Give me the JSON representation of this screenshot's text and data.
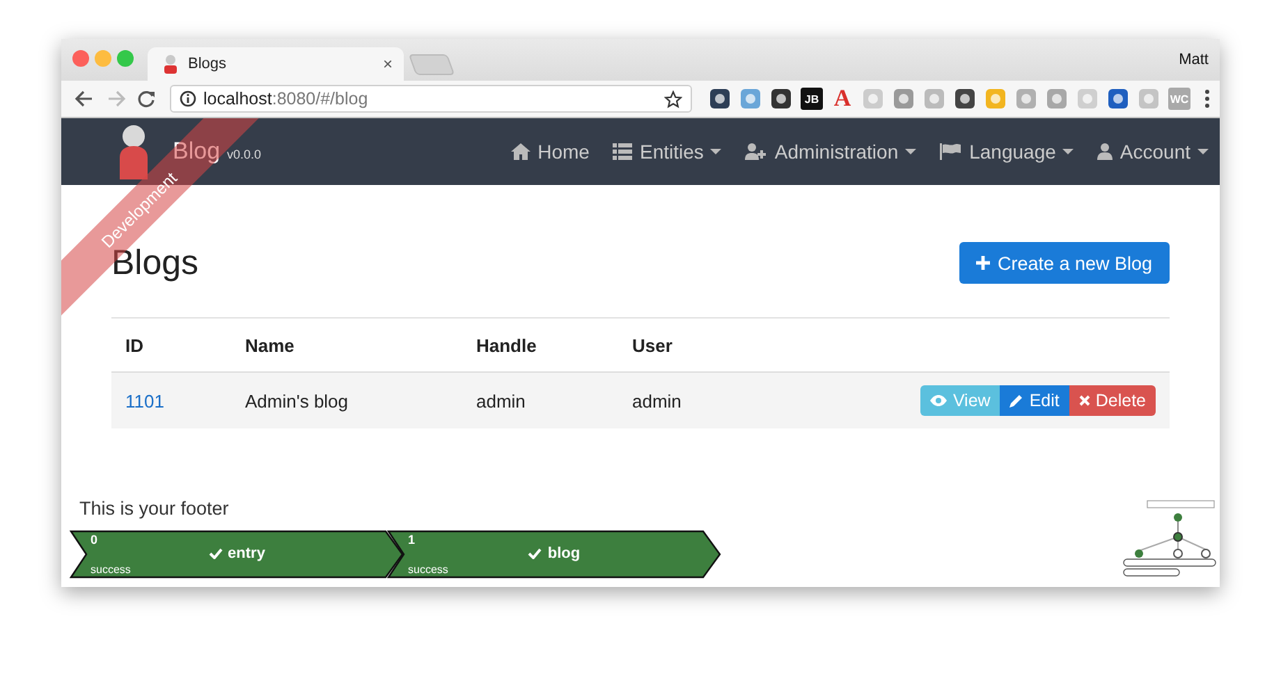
{
  "browser": {
    "tab": {
      "title": "Blogs",
      "close": "×"
    },
    "profile": "Matt",
    "address": {
      "host": "localhost",
      "path": ":8080/#/blog"
    },
    "extensions": [
      {
        "kind": "icon",
        "color": "#2d3e56"
      },
      {
        "kind": "icon",
        "color": "#6aa6d8"
      },
      {
        "kind": "icon",
        "color": "#333333"
      },
      {
        "kind": "badge",
        "label": "JB",
        "color": "#111111"
      },
      {
        "kind": "letter",
        "label": "A",
        "color": "#d9302c"
      },
      {
        "kind": "icon",
        "color": "#cccccc"
      },
      {
        "kind": "icon",
        "color": "#9a9a9a"
      },
      {
        "kind": "icon",
        "color": "#bbbbbb"
      },
      {
        "kind": "icon",
        "color": "#444444"
      },
      {
        "kind": "icon",
        "color": "#f2b520"
      },
      {
        "kind": "icon",
        "color": "#b0b0b0"
      },
      {
        "kind": "icon",
        "color": "#a8a8a8"
      },
      {
        "kind": "icon",
        "color": "#cfcfcf"
      },
      {
        "kind": "icon",
        "color": "#1f5fbf"
      },
      {
        "kind": "icon",
        "color": "#c4c4c4"
      },
      {
        "kind": "badge",
        "label": "WC",
        "color": "#a9a9a9"
      }
    ]
  },
  "navbar": {
    "brand": "Blog",
    "version": "v0.0.0",
    "ribbon": "Development",
    "items": [
      {
        "label": "Home",
        "dropdown": false
      },
      {
        "label": "Entities",
        "dropdown": true
      },
      {
        "label": "Administration",
        "dropdown": true
      },
      {
        "label": "Language",
        "dropdown": true
      },
      {
        "label": "Account",
        "dropdown": true
      }
    ]
  },
  "page": {
    "title": "Blogs",
    "create_button": "Create a new Blog",
    "table": {
      "columns": [
        "ID",
        "Name",
        "Handle",
        "User"
      ],
      "rows": [
        {
          "id": "1101",
          "name": "Admin's blog",
          "handle": "admin",
          "user": "admin"
        }
      ],
      "actions": [
        {
          "label": "View",
          "kind": "info"
        },
        {
          "label": "Edit",
          "kind": "primary"
        },
        {
          "label": "Delete",
          "kind": "danger"
        }
      ]
    }
  },
  "footer": {
    "text": "This is your footer",
    "states": [
      {
        "index": "0",
        "status": "success",
        "name": "entry"
      },
      {
        "index": "1",
        "status": "success",
        "name": "blog"
      }
    ]
  }
}
